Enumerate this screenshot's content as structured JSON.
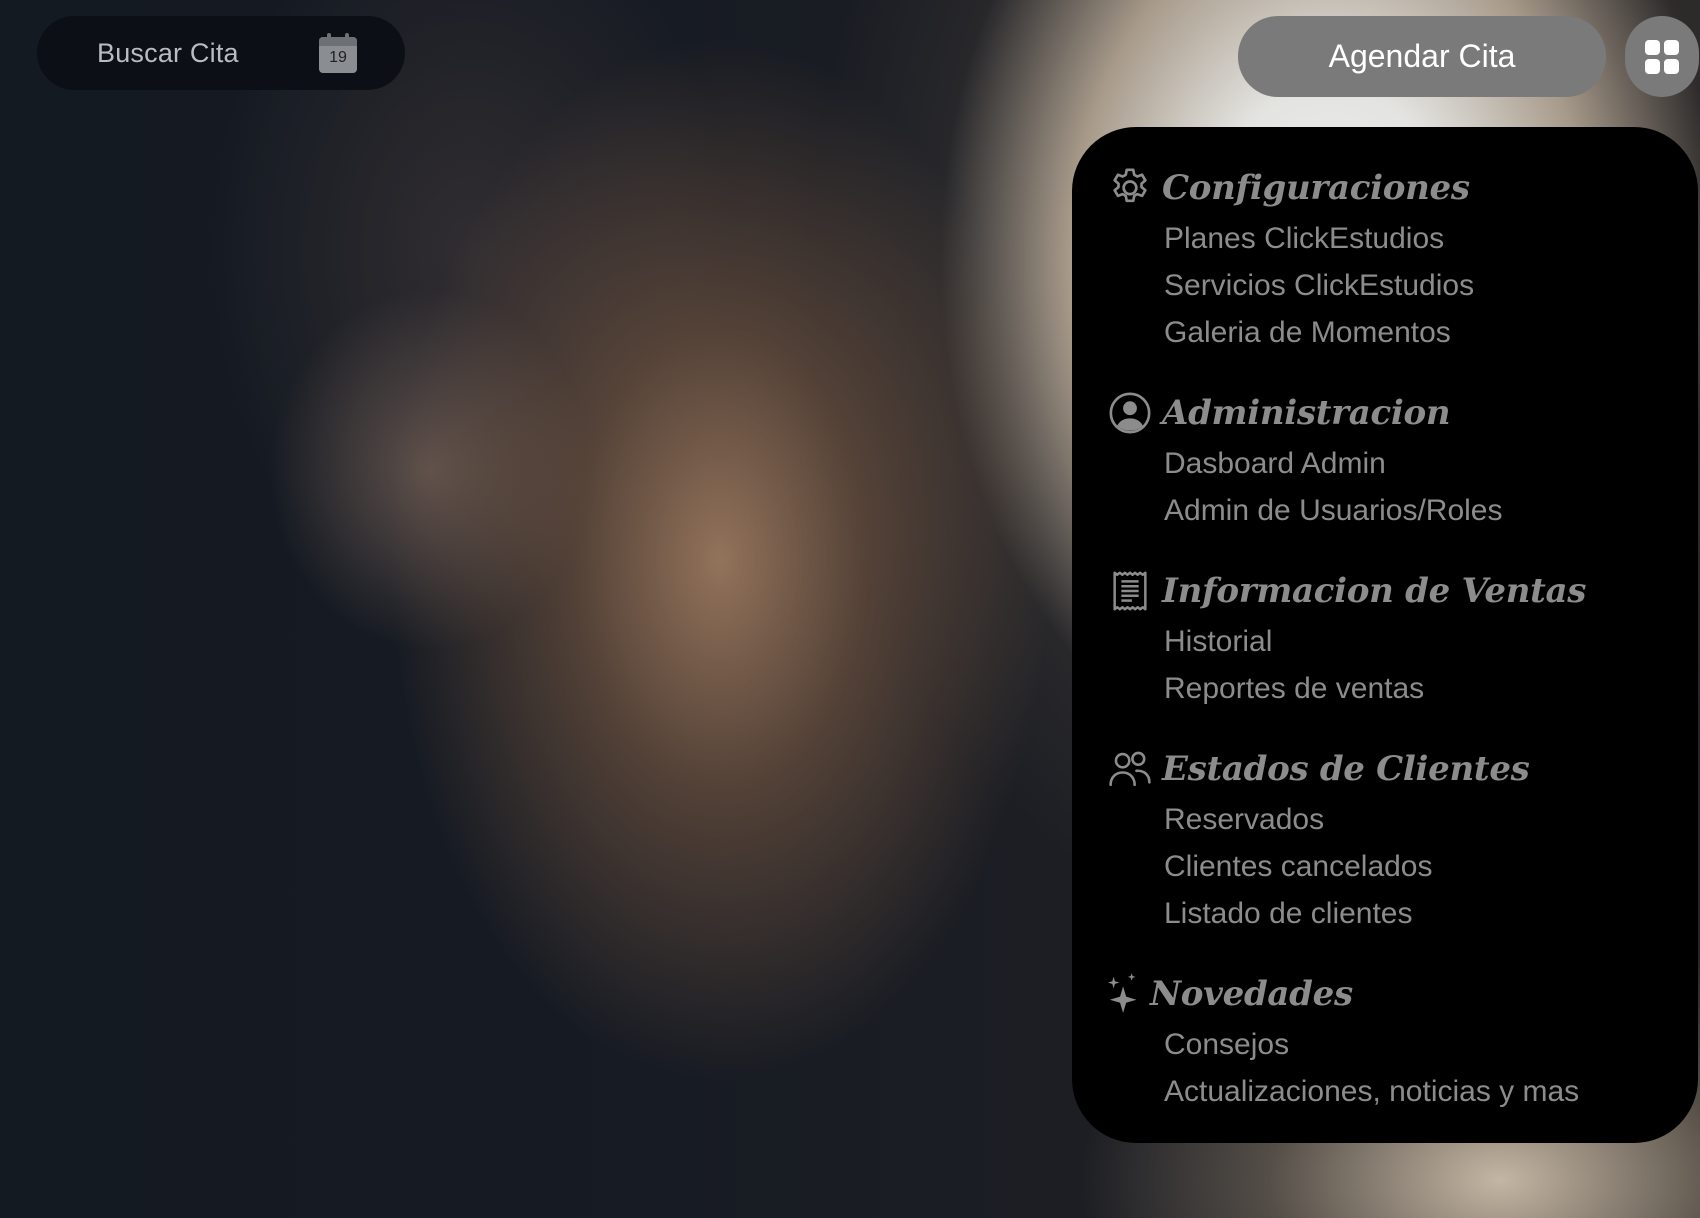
{
  "search": {
    "label": "Buscar Cita",
    "calendar_day": "19"
  },
  "header": {
    "agendar_label": "Agendar Cita",
    "apps_icon": "grid-icon"
  },
  "menu": {
    "sections": [
      {
        "title": "Configuraciones",
        "icon": "gear-icon",
        "items": [
          "Planes ClickEstudios",
          "Servicios ClickEstudios",
          "Galeria de Momentos"
        ]
      },
      {
        "title": "Administracion",
        "icon": "user-circle-icon",
        "items": [
          "Dasboard Admin",
          "Admin de Usuarios/Roles"
        ]
      },
      {
        "title": "Informacion de Ventas",
        "icon": "receipt-icon",
        "items": [
          "Historial",
          "Reportes de ventas"
        ]
      },
      {
        "title": "Estados de Clientes",
        "icon": "users-icon",
        "items": [
          "Reservados",
          "Clientes cancelados",
          "Listado de clientes"
        ]
      },
      {
        "title": "Novedades",
        "icon": "sparkles-icon",
        "items": [
          "Consejos",
          "Actualizaciones, noticias y mas"
        ]
      }
    ]
  },
  "colors": {
    "menu_background": "#000000",
    "menu_text": "#8c8c8c",
    "button_background": "#7a7a7a",
    "search_background": "#0c1016"
  }
}
